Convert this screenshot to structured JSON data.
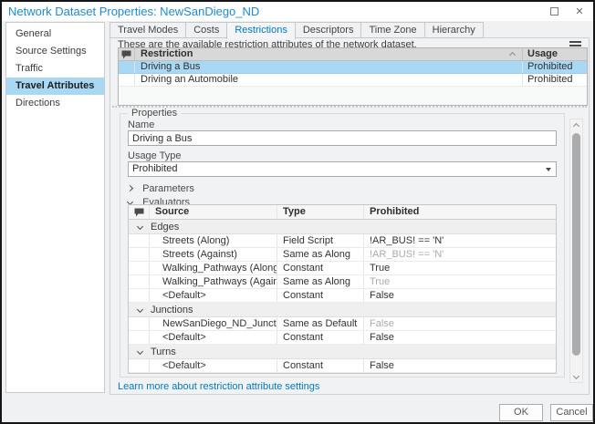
{
  "window": {
    "title": "Network Dataset Properties: NewSanDiego_ND"
  },
  "sidebar": {
    "items": [
      "General",
      "Source Settings",
      "Traffic",
      "Travel Attributes",
      "Directions"
    ],
    "selected": "Travel Attributes"
  },
  "tabs": [
    "Travel Modes",
    "Costs",
    "Restrictions",
    "Descriptors",
    "Time Zone",
    "Hierarchy"
  ],
  "selected_tab": "Restrictions",
  "restrictions": {
    "intro": "These are the available restriction attributes of the network dataset.",
    "header": {
      "name": "Restriction",
      "usage": "Usage"
    },
    "rows": [
      {
        "name": "Driving a Bus",
        "usage": "Prohibited",
        "selected": true
      },
      {
        "name": "Driving an Automobile",
        "usage": "Prohibited",
        "selected": false
      }
    ]
  },
  "properties": {
    "legend": "Properties",
    "name_label": "Name",
    "name_value": "Driving a Bus",
    "usage_type_label": "Usage Type",
    "usage_type_value": "Prohibited",
    "parameters_label": "Parameters",
    "evaluators_label": "Evaluators",
    "table": {
      "header": {
        "source": "Source",
        "type": "Type",
        "value": "Prohibited"
      },
      "groups": [
        {
          "name": "Edges",
          "rows": [
            {
              "source": "Streets (Along)",
              "type": "Field Script",
              "value": "!AR_BUS! == 'N'",
              "inherited": false
            },
            {
              "source": "Streets (Against)",
              "type": "Same as Along",
              "value": "!AR_BUS! == 'N'",
              "inherited": true
            },
            {
              "source": "Walking_Pathways (Along)",
              "type": "Constant",
              "value": "True",
              "inherited": false
            },
            {
              "source": "Walking_Pathways (Against)",
              "type": "Same as Along",
              "value": "True",
              "inherited": true
            },
            {
              "source": "<Default>",
              "type": "Constant",
              "value": "False",
              "inherited": false
            }
          ]
        },
        {
          "name": "Junctions",
          "rows": [
            {
              "source": "NewSanDiego_ND_Junctions",
              "type": "Same as Default",
              "value": "False",
              "inherited": true
            },
            {
              "source": "<Default>",
              "type": "Constant",
              "value": "False",
              "inherited": false
            }
          ]
        },
        {
          "name": "Turns",
          "rows": [
            {
              "source": "<Default>",
              "type": "Constant",
              "value": "False",
              "inherited": false
            }
          ]
        }
      ]
    }
  },
  "learn_more": "Learn more about restriction attribute settings",
  "footer": {
    "ok": "OK",
    "cancel": "Cancel"
  },
  "icons": {
    "maximize": "square-outline",
    "close": "✕",
    "menu": "≡",
    "evaluator_column": "speech-bubble",
    "sort_ascending": "chevron-up",
    "collapsed": "chevron-right",
    "expanded": "chevron-down",
    "dropdown": "caret-down"
  },
  "colors": {
    "accent": "#0079C1",
    "title_text": "#2089C9",
    "selection": "#A9D8F4",
    "inherited_text": "#ABABAB"
  }
}
